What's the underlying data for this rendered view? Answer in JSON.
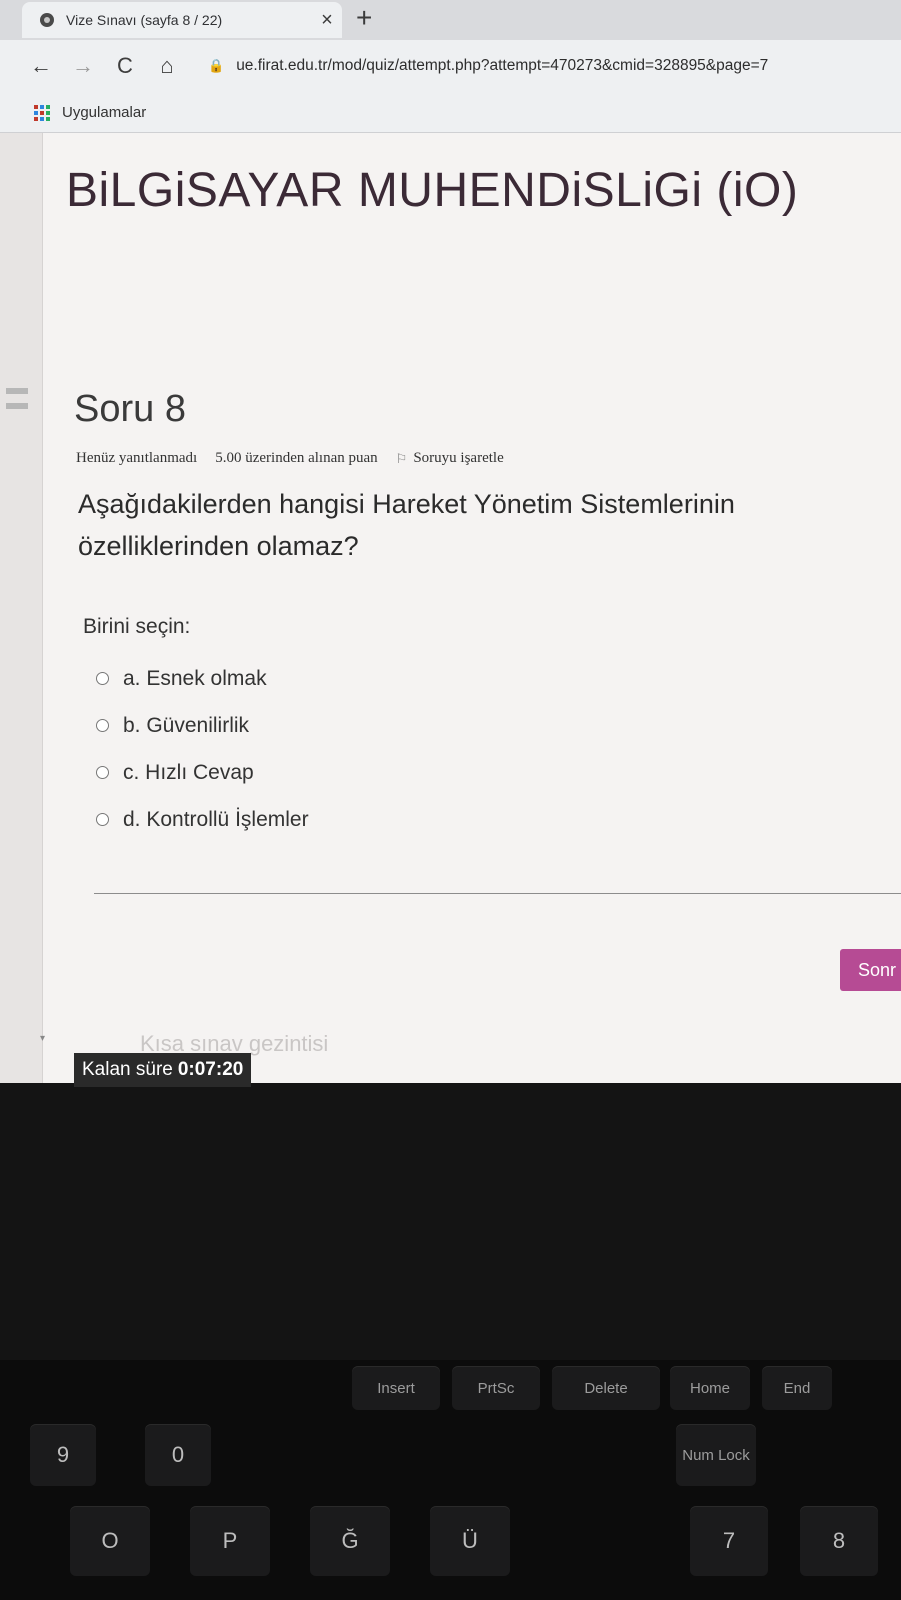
{
  "browser": {
    "tab_title": "Vize Sınavı (sayfa 8 / 22)",
    "tab_close": "×",
    "new_tab": "+",
    "url": "ue.firat.edu.tr/mod/quiz/attempt.php?attempt=470273&cmid=328895&page=7",
    "bookmarks_label": "Uygulamalar",
    "nav": {
      "back": "←",
      "forward": "→",
      "reload": "C",
      "home": "⌂"
    }
  },
  "site": {
    "title": "BiLGiSAYAR MUHENDiSLiGi (iO)"
  },
  "question": {
    "title": "Soru 8",
    "status": "Henüz yanıtlanmadı",
    "points": "5.00 üzerinden alınan puan",
    "flag_label": "Soruyu işaretle",
    "text": "Aşağıdakilerden hangisi Hareket Yönetim Sistemlerinin özelliklerinden olamaz?",
    "prompt": "Birini seçin:",
    "answers": [
      {
        "label": "a. Esnek olmak"
      },
      {
        "label": "b. Güvenilirlik"
      },
      {
        "label": "c. Hızlı Cevap"
      },
      {
        "label": "d. Kontrollü İşlemler"
      }
    ]
  },
  "actions": {
    "next_label": "Sonr"
  },
  "quiz_nav": {
    "link_text": "Kısa sınav gezintisi",
    "timer_label": "Kalan süre",
    "timer_value": "0:07:20"
  },
  "keyboard": {
    "keys": [
      "Insert",
      "PrtSc",
      "Delete",
      "Home",
      "End",
      "Num Lock",
      "9",
      "0",
      "O",
      "P",
      "Ğ",
      "Ü",
      "7",
      "8"
    ]
  }
}
